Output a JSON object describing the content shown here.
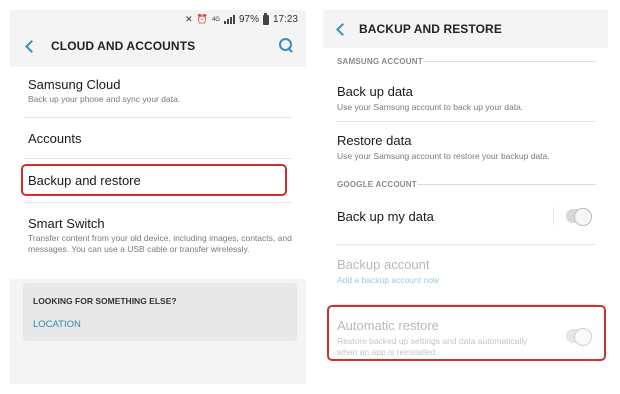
{
  "status_bar": {
    "battery": "97%",
    "time": "17:23"
  },
  "left_screen": {
    "title": "CLOUD AND ACCOUNTS",
    "items": [
      {
        "title": "Samsung Cloud",
        "description": "Back up your phone and sync your data."
      },
      {
        "title": "Accounts",
        "description": ""
      },
      {
        "title": "Backup and restore",
        "description": ""
      },
      {
        "title": "Smart Switch",
        "description": "Transfer content from your old device, including images, contacts, and messages. You can use a USB cable or transfer wirelessly."
      }
    ],
    "looking_box": {
      "title": "LOOKING FOR SOMETHING ELSE?",
      "link": "LOCATION"
    }
  },
  "right_screen": {
    "title": "BACKUP AND RESTORE",
    "sections": [
      {
        "label": "SAMSUNG ACCOUNT",
        "items": [
          {
            "title": "Back up data",
            "description": "Use your Samsung account to back up your data."
          },
          {
            "title": "Restore data",
            "description": "Use your Samsung account to restore your backup data."
          }
        ]
      },
      {
        "label": "GOOGLE ACCOUNT",
        "items": [
          {
            "title": "Back up my data",
            "toggle": "off"
          },
          {
            "title": "Backup account",
            "description": "Add a backup account now",
            "enabled": false
          },
          {
            "title": "Automatic restore",
            "description": "Restore backed up settings and data automatically when an app is reinstalled",
            "toggle": "on",
            "enabled": false
          }
        ]
      }
    ]
  },
  "colors": {
    "accent": "#3a8fbf",
    "highlight": "#d12f2f",
    "link": "#2d8aa8"
  }
}
